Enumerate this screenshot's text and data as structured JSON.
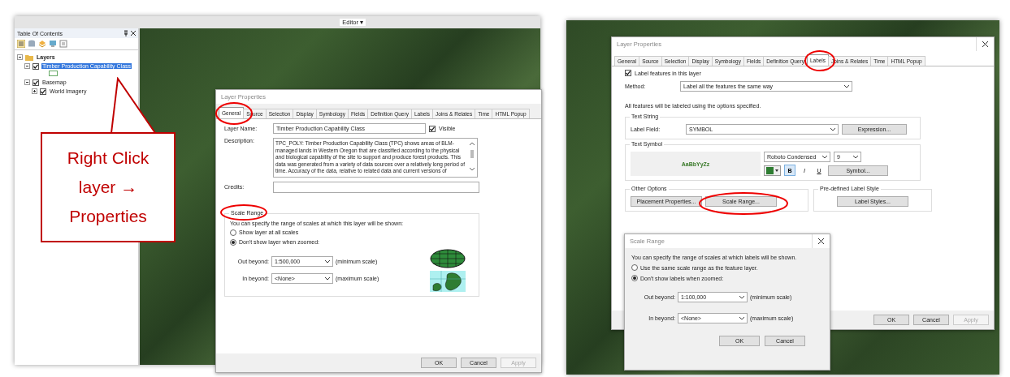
{
  "left": {
    "toolbar_label": "Editor ▾",
    "toc": {
      "title": "Table Of Contents",
      "tree": [
        {
          "label": "Layers",
          "expanded": true,
          "selected": false,
          "children": [
            {
              "label": "Timber Production Capability Class",
              "checked": true,
              "expanded": true,
              "selected": true
            },
            {
              "label": "Basemap",
              "checked": true,
              "expanded": true,
              "selected": false,
              "children": [
                {
                  "label": "World Imagery",
                  "checked": true,
                  "expanded": false,
                  "selected": false
                }
              ]
            }
          ]
        }
      ]
    },
    "callout": "Right Click layer → Properties",
    "dialog": {
      "title": "Layer Properties",
      "tabs": [
        {
          "label": "General",
          "selected": true
        },
        {
          "label": "Source",
          "selected": false
        },
        {
          "label": "Selection",
          "selected": false
        },
        {
          "label": "Display",
          "selected": false
        },
        {
          "label": "Symbology",
          "selected": false
        },
        {
          "label": "Fields",
          "selected": false
        },
        {
          "label": "Definition Query",
          "selected": false
        },
        {
          "label": "Labels",
          "selected": false
        },
        {
          "label": "Joins & Relates",
          "selected": false
        },
        {
          "label": "Time",
          "selected": false
        },
        {
          "label": "HTML Popup",
          "selected": false
        }
      ],
      "layer_name_label": "Layer Name:",
      "layer_name": "Timber Production Capability Class",
      "visible": {
        "label": "Visible",
        "checked": true
      },
      "description_label": "Description:",
      "description": "TPC_POLY: Timber Production Capability Class (TPC) shows areas of BLM-managed lands in Western Oregon that are classified according to the physical and biological capability of the site to support and produce forest products. This data was generated from a variety of data sources over a relatively long period of time. Accuracy of the data, relative to related data and current versions of",
      "credits_label": "Credits:",
      "scale_range": {
        "title": "Scale Range",
        "intro": "You can specify the range of scales at which this layer will be shown:",
        "options": [
          {
            "label": "Show layer at all scales",
            "selected": false
          },
          {
            "label": "Don't show layer when zoomed:",
            "selected": true
          }
        ],
        "out_label": "Out beyond:",
        "out_value": "1:500,000",
        "out_note": "(minimum scale)",
        "in_label": "In beyond:",
        "in_value": "<None>",
        "in_note": "(maximum scale)"
      },
      "buttons": [
        {
          "label": "OK",
          "disabled": false
        },
        {
          "label": "Cancel",
          "disabled": false
        },
        {
          "label": "Apply",
          "disabled": true
        }
      ]
    }
  },
  "right": {
    "dialog": {
      "title": "Layer Properties",
      "tabs": [
        {
          "label": "General",
          "selected": false
        },
        {
          "label": "Source",
          "selected": false
        },
        {
          "label": "Selection",
          "selected": false
        },
        {
          "label": "Display",
          "selected": false
        },
        {
          "label": "Symbology",
          "selected": false
        },
        {
          "label": "Fields",
          "selected": false
        },
        {
          "label": "Definition Query",
          "selected": false
        },
        {
          "label": "Labels",
          "selected": true
        },
        {
          "label": "Joins & Relates",
          "selected": false
        },
        {
          "label": "Time",
          "selected": false
        },
        {
          "label": "HTML Popup",
          "selected": false
        }
      ],
      "label_features": {
        "label": "Label features in this layer",
        "checked": true
      },
      "method_label": "Method:",
      "method_value": "Label all the features the same way",
      "info": "All features will be labeled using the options specified.",
      "text_string": {
        "title": "Text String",
        "field_label": "Label Field:",
        "field_value": "SYMBOL",
        "button": "Expression..."
      },
      "text_symbol": {
        "title": "Text Symbol",
        "preview": "AaBbYyZz",
        "font": "Roboto Condensed",
        "size": "9",
        "styles": [
          {
            "label": "B",
            "selected": true
          },
          {
            "label": "I",
            "selected": false
          },
          {
            "label": "U",
            "selected": false
          }
        ],
        "button": "Symbol..."
      },
      "other_options": {
        "title": "Other Options",
        "buttons": [
          "Placement Properties...",
          "Scale Range..."
        ]
      },
      "predefined": {
        "title": "Pre-defined Label Style",
        "button": "Label Styles..."
      },
      "buttons": [
        {
          "label": "OK",
          "disabled": false
        },
        {
          "label": "Cancel",
          "disabled": false
        },
        {
          "label": "Apply",
          "disabled": true
        }
      ]
    },
    "scale_dialog": {
      "title": "Scale Range",
      "intro": "You can specify the range of scales at which labels will be shown.",
      "options": [
        {
          "label": "Use the same scale range as the feature layer.",
          "selected": false
        },
        {
          "label": "Don't show labels when zoomed:",
          "selected": true
        }
      ],
      "out_label": "Out beyond:",
      "out_value": "1:100,000",
      "out_note": "(minimum scale)",
      "in_label": "In beyond:",
      "in_value": "<None>",
      "in_note": "(maximum scale)",
      "buttons": [
        {
          "label": "OK",
          "disabled": false
        },
        {
          "label": "Cancel",
          "disabled": false
        }
      ]
    }
  }
}
